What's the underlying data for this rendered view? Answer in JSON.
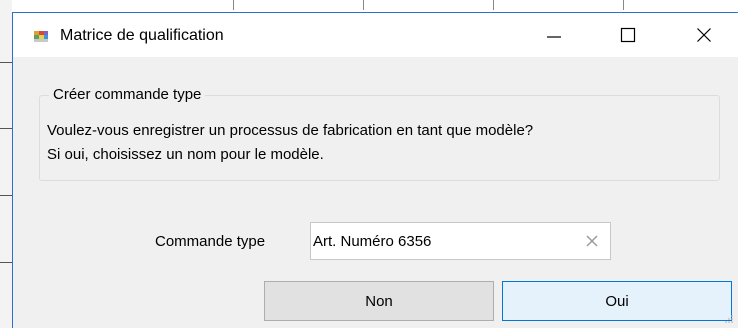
{
  "window": {
    "title": "Matrice de qualification",
    "icons": {
      "app": "matrix-app-icon",
      "minimize": "minimize-icon",
      "maximize": "maximize-icon",
      "close": "close-icon"
    }
  },
  "group": {
    "legend": "Créer commande type",
    "message_line1": "Voulez-vous enregistrer un processus de fabrication en tant que modèle?",
    "message_line2": "Si oui, choisissez un nom pour le modèle."
  },
  "field": {
    "label": "Commande type",
    "value": "Art. Numéro 6356",
    "clear_icon": "clear-x-icon"
  },
  "buttons": {
    "no_label": "Non",
    "yes_label": "Oui"
  },
  "colors": {
    "accent": "#0078d7",
    "window_border": "#2a72c9",
    "background": "#f0f0f0",
    "no_button": "#e1e1e1",
    "yes_button": "#e5f1fb"
  }
}
